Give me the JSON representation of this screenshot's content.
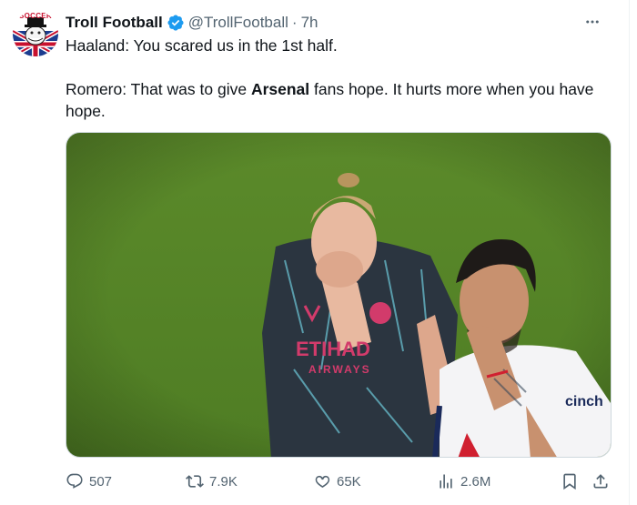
{
  "tweet": {
    "author_name": "Troll Football",
    "handle": "@TrollFootball",
    "separator": "·",
    "time": "7h",
    "avatar_text": "SOCCER",
    "line1": "Haaland: You scared us in the 1st half.",
    "line2_before": "Romero: That was to give ",
    "line2_bold": "Arsenal",
    "line2_after": " fans hope. It hurts more when you have hope."
  },
  "media": {
    "shirt_left_text": "ETIHAD",
    "shirt_left_subtext": "AIRWAYS",
    "shirt_right_text": "cinch"
  },
  "actions": {
    "replies": "507",
    "reposts": "7.9K",
    "likes": "65K",
    "views": "2.6M"
  },
  "icons": {
    "reply": "reply-icon",
    "repost": "repost-icon",
    "like": "heart-icon",
    "views": "views-icon",
    "bookmark": "bookmark-icon",
    "share": "share-icon",
    "verified": "verified-badge-icon",
    "more": "more-options-icon"
  },
  "colors": {
    "text": "#0f1419",
    "secondary": "#536471",
    "verified": "#1d9bf0",
    "pitch": "#5f8a2c"
  }
}
